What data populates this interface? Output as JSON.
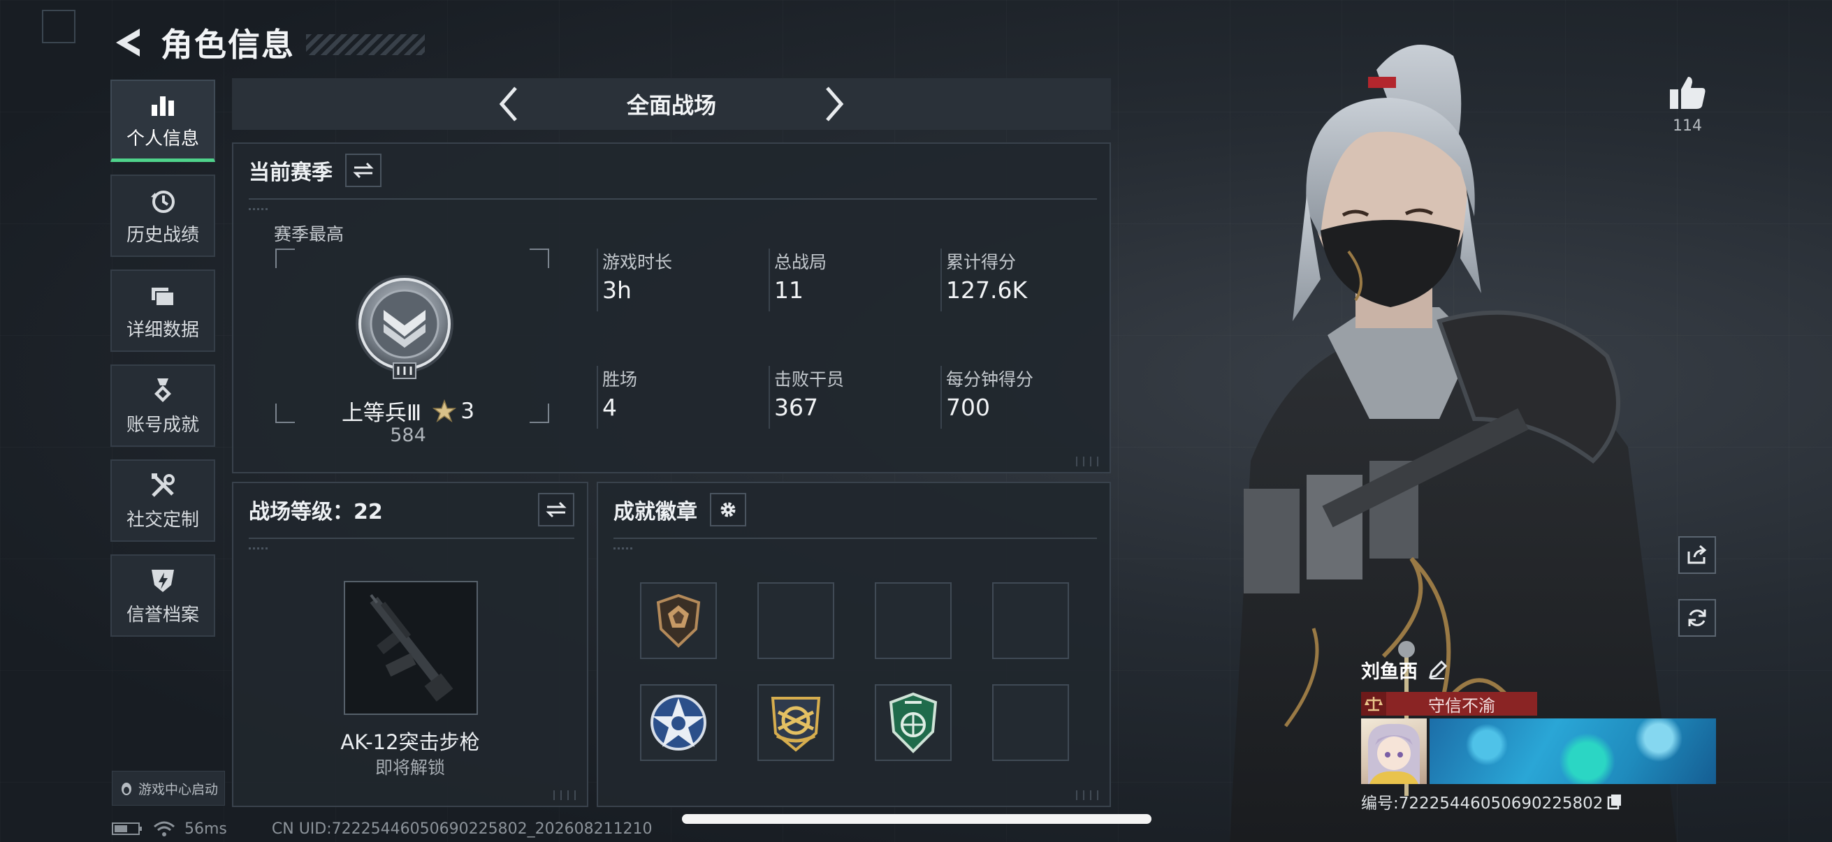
{
  "header": {
    "title": "角色信息"
  },
  "nav": {
    "items": [
      {
        "label": "个人信息",
        "icon": "bar-chart-icon",
        "active": true
      },
      {
        "label": "历史战绩",
        "icon": "history-icon",
        "active": false
      },
      {
        "label": "详细数据",
        "icon": "folder-icon",
        "active": false
      },
      {
        "label": "账号成就",
        "icon": "medal-icon",
        "active": false
      },
      {
        "label": "社交定制",
        "icon": "tools-icon",
        "active": false
      },
      {
        "label": "信誉档案",
        "icon": "credit-shield-icon",
        "active": false
      }
    ],
    "game_center": "游戏中心启动"
  },
  "mode": {
    "label": "全面战场"
  },
  "season": {
    "title": "当前赛季",
    "best_label": "赛季最高",
    "rank_name": "上等兵Ⅲ",
    "rank_stars": "3",
    "rank_score": "584",
    "stats": [
      {
        "label": "游戏时长",
        "value": "3h"
      },
      {
        "label": "总战局",
        "value": "11"
      },
      {
        "label": "累计得分",
        "value": "127.6K"
      },
      {
        "label": "胜场",
        "value": "4"
      },
      {
        "label": "击败干员",
        "value": "367"
      },
      {
        "label": "每分钟得分",
        "value": "700"
      }
    ]
  },
  "level": {
    "title": "战场等级：22",
    "weapon_name": "AK-12突击步枪",
    "weapon_status": "即将解锁"
  },
  "badges": {
    "title": "成就徽章",
    "slots": [
      {
        "icon": "bronze-shield-badge-icon"
      },
      {
        "icon": ""
      },
      {
        "icon": ""
      },
      {
        "icon": ""
      },
      {
        "icon": "blue-star-badge-icon"
      },
      {
        "icon": "gold-emblem-badge-icon"
      },
      {
        "icon": "green-shield-badge-icon"
      },
      {
        "icon": ""
      }
    ]
  },
  "profile": {
    "likes": "114",
    "player_name": "刘鱼西",
    "honor_title": "守信不渝",
    "id_line": "编号:72225446050690225802"
  },
  "status": {
    "ping": "56ms",
    "cn_uid": "CN UID:72225446050690225802_202608211210"
  },
  "colors": {
    "accent": "#4fd38b",
    "honor": "#8a2424"
  }
}
